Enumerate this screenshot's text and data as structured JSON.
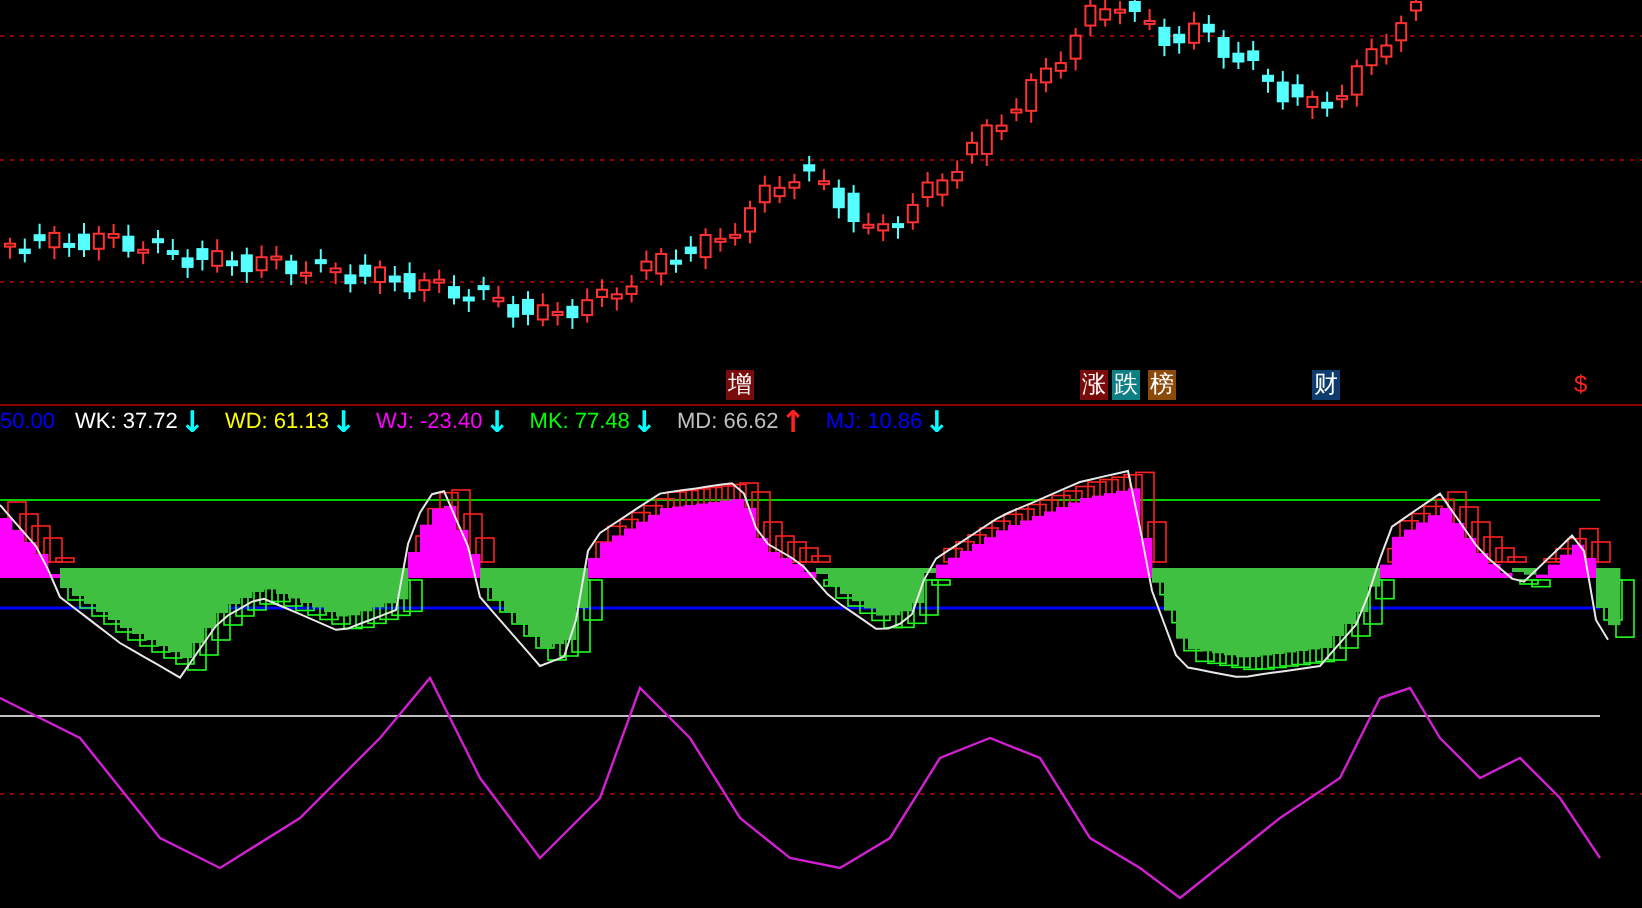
{
  "event_tags": [
    {
      "text": "增",
      "color": "#7a0b0b"
    },
    {
      "text": "涨",
      "color": "#7a0b0b"
    },
    {
      "text": "跌",
      "color": "#0f7f86"
    },
    {
      "text": "榜",
      "color": "#8a4a0a"
    },
    {
      "text": "财",
      "color": "#0e3c6e"
    },
    {
      "text": "$",
      "color": "#000000"
    }
  ],
  "indicator_legend": [
    {
      "text": "50.00",
      "color": "#0000ff"
    },
    {
      "text": "WK: 37.72",
      "arrow": {
        "text": "↓",
        "color": "#00ffff"
      },
      "color": "#ffffff"
    },
    {
      "text": "WD: 61.13",
      "arrow": {
        "text": "↓",
        "color": "#00ffff"
      },
      "color": "#ffff00"
    },
    {
      "text": "WJ: -23.40",
      "arrow": {
        "text": "↓",
        "color": "#00ffff"
      },
      "color": "#ff00ff"
    },
    {
      "text": "MK: 77.48",
      "arrow": {
        "text": "↓",
        "color": "#00ffff"
      },
      "color": "#00ff00"
    },
    {
      "text": "MD: 66.62",
      "arrow": {
        "text": "↑",
        "color": "#ff2020"
      },
      "color": "#c0c0c0"
    },
    {
      "text": "MJ: 10.86",
      "arrow": {
        "text": "↓",
        "color": "#00ffff"
      },
      "color": "#0000ff"
    }
  ]
}
